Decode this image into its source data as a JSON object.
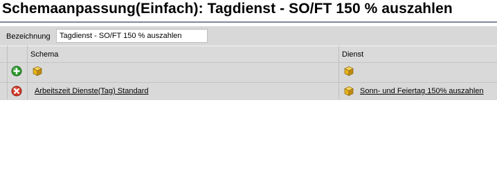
{
  "page": {
    "title": "Schemaanpassung(Einfach): Tagdienst - SO/FT 150 % auszahlen"
  },
  "form": {
    "name_label": "Bezeichnung",
    "name_value": "Tagdienst - SO/FT 150 % auszahlen"
  },
  "table": {
    "columns": [
      "Schema",
      "Dienst"
    ],
    "new_row": {
      "action_icon": "add-icon",
      "schema_icon": "cube-icon",
      "dienst_icon": "cube-icon"
    },
    "rows": [
      {
        "action_icon": "delete-icon",
        "schema": "Arbeitszeit Dienste(Tag) Standard",
        "dienst_icon": "cube-icon",
        "dienst": "Sonn- und Feiertag 150% auszahlen"
      }
    ]
  },
  "colors": {
    "add": "#2e9a2e",
    "delete": "#d63a2a",
    "cube": "#e7b21f"
  }
}
